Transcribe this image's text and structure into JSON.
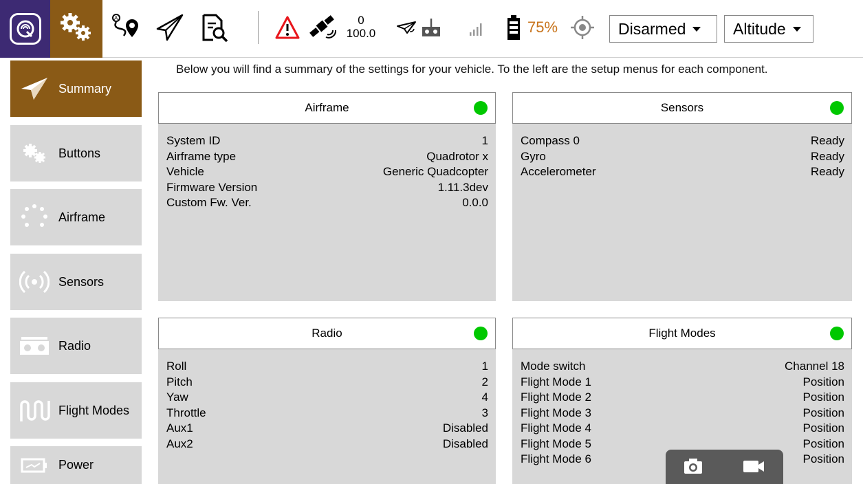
{
  "toolbar": {
    "icons": {
      "logo": "qgc-logo-icon",
      "settings": "gears-icon",
      "plan": "plan-route-icon",
      "fly": "paper-plane-icon",
      "analyze": "analyze-document-icon",
      "warning": "warning-icon",
      "gps": "satellite-icon",
      "telemetry": "telemetry-plane-icon",
      "rc": "rc-transmitter-icon",
      "battery": "battery-icon",
      "gps_target": "crosshair-icon"
    },
    "gps_count": "0",
    "gps_hdop": "100.0",
    "battery_pct": "75%",
    "armed_state": "Disarmed",
    "flight_mode": "Altitude",
    "colors": {
      "logo_bg": "#3d2a73",
      "active_bg": "#8a5a16",
      "battery_text": "#c8741c",
      "warning": "#e8151b"
    }
  },
  "sidebar": {
    "items": [
      {
        "label": "Summary",
        "icon": "paper-plane-icon",
        "active": true
      },
      {
        "label": "Buttons",
        "icon": "gears-icon",
        "active": false
      },
      {
        "label": "Airframe",
        "icon": "airframe-dots-icon",
        "active": false
      },
      {
        "label": "Sensors",
        "icon": "sensor-waves-icon",
        "active": false
      },
      {
        "label": "Radio",
        "icon": "radio-controller-icon",
        "active": false
      },
      {
        "label": "Flight Modes",
        "icon": "flight-modes-wave-icon",
        "active": false
      },
      {
        "label": "Power",
        "icon": "power-battery-icon",
        "active": false
      }
    ]
  },
  "main": {
    "intro": "Below you will find a summary of the settings for your vehicle. To the left are the setup menus for each component.",
    "panels": {
      "airframe": {
        "title": "Airframe",
        "status_color": "#00c800",
        "rows": [
          {
            "label": "System ID",
            "value": "1"
          },
          {
            "label": "Airframe type",
            "value": "Quadrotor x"
          },
          {
            "label": "Vehicle",
            "value": "Generic Quadcopter"
          },
          {
            "label": "Firmware Version",
            "value": "1.11.3dev"
          },
          {
            "label": "Custom Fw. Ver.",
            "value": "0.0.0"
          }
        ]
      },
      "sensors": {
        "title": "Sensors",
        "status_color": "#00c800",
        "rows": [
          {
            "label": "Compass 0",
            "value": "Ready"
          },
          {
            "label": "Gyro",
            "value": "Ready"
          },
          {
            "label": "Accelerometer",
            "value": "Ready"
          }
        ]
      },
      "radio": {
        "title": "Radio",
        "status_color": "#00c800",
        "rows": [
          {
            "label": "Roll",
            "value": "1"
          },
          {
            "label": "Pitch",
            "value": "2"
          },
          {
            "label": "Yaw",
            "value": "4"
          },
          {
            "label": "Throttle",
            "value": "3"
          },
          {
            "label": "Aux1",
            "value": "Disabled"
          },
          {
            "label": "Aux2",
            "value": "Disabled"
          }
        ]
      },
      "flight_modes": {
        "title": "Flight Modes",
        "status_color": "#00c800",
        "rows": [
          {
            "label": "Mode switch",
            "value": "Channel 18"
          },
          {
            "label": "Flight Mode 1",
            "value": "Position"
          },
          {
            "label": "Flight Mode 2",
            "value": "Position"
          },
          {
            "label": "Flight Mode 3",
            "value": "Position"
          },
          {
            "label": "Flight Mode 4",
            "value": "Position"
          },
          {
            "label": "Flight Mode 5",
            "value": "Position"
          },
          {
            "label": "Flight Mode 6",
            "value": "Position"
          }
        ]
      }
    }
  },
  "camera_bar": {
    "photo_icon": "camera-icon",
    "video_icon": "video-camera-icon"
  }
}
